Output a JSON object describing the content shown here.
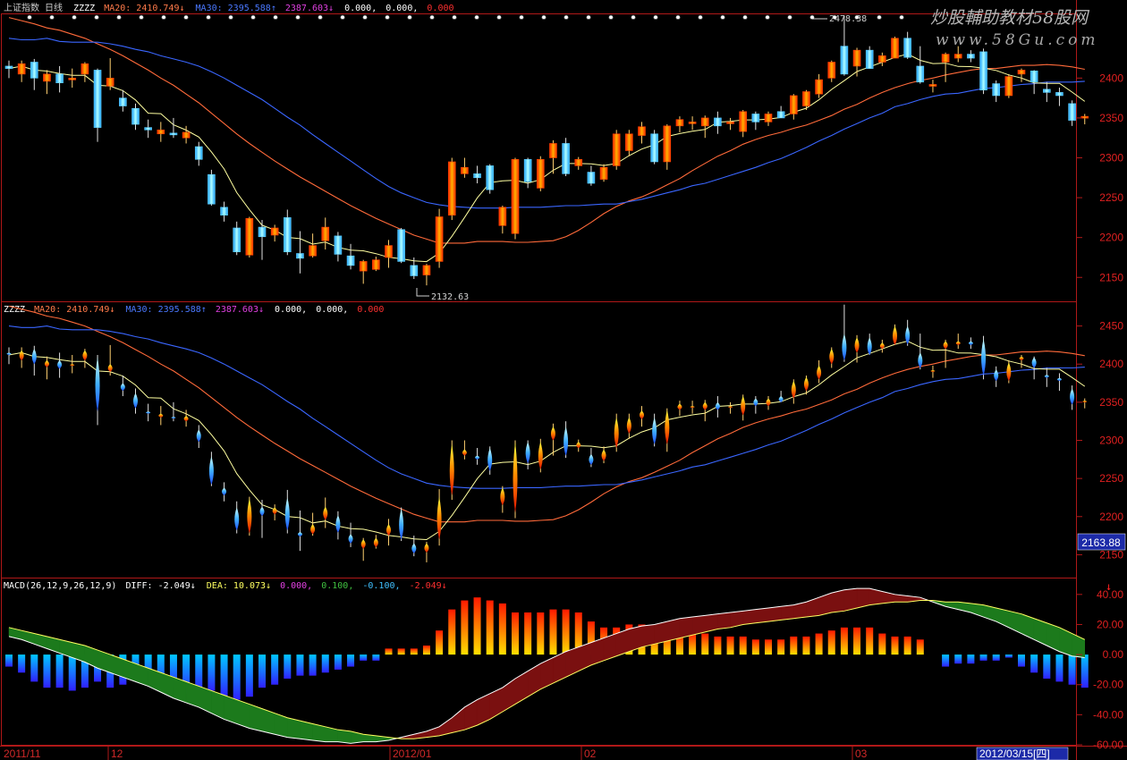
{
  "header": {
    "top": {
      "prefix": "上证指数 日线",
      "ind": "ZZZZ",
      "ma20": "MA20: 2410.749↓",
      "ma30": "MA30: 2395.588↑",
      "v3": "2387.603↓",
      "v4": "0.000,",
      "v5": "0.000,",
      "v6": "0.000"
    },
    "mid": {
      "ind": "ZZZZ",
      "ma20": "MA20: 2410.749↓",
      "ma30": "MA30: 2395.588↑",
      "v3": "2387.603↓",
      "v4": "0.000,",
      "v5": "0.000,",
      "v6": "0.000"
    },
    "macd": {
      "name": "MACD(26,12,9,26,12,9)",
      "diff": "DIFF: -2.049↓",
      "dea": "DEA: 10.073↓",
      "v3": "0.000,",
      "v4": "0.100,",
      "v5": "-0.100,",
      "v6": "-2.049↓"
    }
  },
  "watermark": {
    "line1": "炒股輔助教材58股网",
    "line2": "www.58Gu.com"
  },
  "annotations": {
    "high": "2478.38",
    "low": "2132.63",
    "last_price": "2163.88"
  },
  "date_axis": [
    "2011/11",
    "12",
    "2012/01",
    "02",
    "03"
  ],
  "date_cursor": "2012/03/15[四]",
  "colors": {
    "background": "#000000",
    "frame": "#b01818",
    "ma20": "#ff6a3a",
    "ma30": "#3a66ff",
    "ma5": "#ffffa0",
    "up": "#ffb000",
    "down": "#40d8ff",
    "hist_up": "#ff3000",
    "hist_down": "#2040ff"
  },
  "chart_data": [
    {
      "type": "candlestick",
      "panel": "price",
      "ylim": [
        2120,
        2480
      ],
      "yticks": [
        "2400",
        "2350",
        "2300",
        "2250",
        "2200",
        "2150"
      ],
      "candles": [
        [
          2415,
          2412,
          2422,
          2400
        ],
        [
          2405,
          2418,
          2422,
          2395
        ],
        [
          2420,
          2400,
          2424,
          2385
        ],
        [
          2396,
          2405,
          2410,
          2380
        ],
        [
          2405,
          2394,
          2415,
          2382
        ],
        [
          2398,
          2400,
          2412,
          2388
        ],
        [
          2405,
          2418,
          2420,
          2395
        ],
        [
          2410,
          2338,
          2412,
          2320
        ],
        [
          2390,
          2400,
          2425,
          2385
        ],
        [
          2375,
          2365,
          2385,
          2358
        ],
        [
          2362,
          2342,
          2368,
          2335
        ],
        [
          2338,
          2335,
          2348,
          2325
        ],
        [
          2330,
          2335,
          2345,
          2320
        ],
        [
          2331,
          2330,
          2350,
          2325
        ],
        [
          2325,
          2332,
          2340,
          2318
        ],
        [
          2314,
          2298,
          2320,
          2290
        ],
        [
          2279,
          2242,
          2285,
          2240
        ],
        [
          2238,
          2228,
          2245,
          2220
        ],
        [
          2212,
          2182,
          2220,
          2178
        ],
        [
          2178,
          2224,
          2226,
          2175
        ],
        [
          2213,
          2201,
          2222,
          2172
        ],
        [
          2203,
          2212,
          2216,
          2195
        ],
        [
          2225,
          2182,
          2235,
          2178
        ],
        [
          2180,
          2174,
          2208,
          2155
        ],
        [
          2177,
          2190,
          2205,
          2175
        ],
        [
          2196,
          2213,
          2225,
          2185
        ],
        [
          2202,
          2179,
          2207,
          2170
        ],
        [
          2177,
          2165,
          2192,
          2160
        ],
        [
          2158,
          2170,
          2172,
          2142
        ],
        [
          2160,
          2172,
          2176,
          2158
        ],
        [
          2175,
          2190,
          2197,
          2162
        ],
        [
          2210,
          2170,
          2212,
          2168
        ],
        [
          2165,
          2152,
          2175,
          2148
        ],
        [
          2153,
          2165,
          2167,
          2140
        ],
        [
          2170,
          2226,
          2236,
          2162
        ],
        [
          2228,
          2295,
          2300,
          2222
        ],
        [
          2280,
          2288,
          2300,
          2275
        ],
        [
          2280,
          2275,
          2290,
          2268
        ],
        [
          2290,
          2260,
          2292,
          2255
        ],
        [
          2215,
          2238,
          2240,
          2205
        ],
        [
          2205,
          2298,
          2300,
          2198
        ],
        [
          2298,
          2270,
          2300,
          2262
        ],
        [
          2262,
          2298,
          2302,
          2258
        ],
        [
          2300,
          2318,
          2322,
          2280
        ],
        [
          2318,
          2280,
          2325,
          2277
        ],
        [
          2290,
          2298,
          2301,
          2285
        ],
        [
          2282,
          2268,
          2290,
          2265
        ],
        [
          2273,
          2288,
          2292,
          2270
        ],
        [
          2290,
          2330,
          2335,
          2285
        ],
        [
          2309,
          2330,
          2335,
          2302
        ],
        [
          2328,
          2339,
          2345,
          2318
        ],
        [
          2330,
          2295,
          2335,
          2292
        ],
        [
          2295,
          2340,
          2342,
          2285
        ],
        [
          2340,
          2348,
          2352,
          2332
        ],
        [
          2345,
          2345,
          2352,
          2335
        ],
        [
          2340,
          2350,
          2353,
          2325
        ],
        [
          2350,
          2340,
          2358,
          2330
        ],
        [
          2343,
          2345,
          2350,
          2335
        ],
        [
          2333,
          2358,
          2360,
          2326
        ],
        [
          2355,
          2345,
          2358,
          2335
        ],
        [
          2345,
          2355,
          2358,
          2340
        ],
        [
          2358,
          2350,
          2365,
          2350
        ],
        [
          2355,
          2378,
          2380,
          2348
        ],
        [
          2365,
          2383,
          2385,
          2360
        ],
        [
          2380,
          2398,
          2405,
          2375
        ],
        [
          2400,
          2420,
          2422,
          2395
        ],
        [
          2440,
          2405,
          2478,
          2403
        ],
        [
          2415,
          2435,
          2438,
          2402
        ],
        [
          2435,
          2412,
          2440,
          2412
        ],
        [
          2420,
          2428,
          2432,
          2415
        ],
        [
          2425,
          2450,
          2452,
          2425
        ],
        [
          2450,
          2426,
          2458,
          2424
        ],
        [
          2415,
          2395,
          2440,
          2393
        ],
        [
          2390,
          2392,
          2398,
          2382
        ],
        [
          2420,
          2430,
          2432,
          2395
        ],
        [
          2425,
          2430,
          2440,
          2420
        ],
        [
          2430,
          2425,
          2435,
          2420
        ],
        [
          2433,
          2385,
          2437,
          2380
        ],
        [
          2393,
          2378,
          2397,
          2370
        ],
        [
          2378,
          2402,
          2405,
          2375
        ],
        [
          2405,
          2410,
          2412,
          2395
        ],
        [
          2409,
          2395,
          2410,
          2380
        ],
        [
          2386,
          2382,
          2395,
          2370
        ],
        [
          2382,
          2378,
          2388,
          2365
        ],
        [
          2368,
          2347,
          2372,
          2340
        ],
        [
          2350,
          2352,
          2355,
          2342
        ]
      ],
      "series": [
        {
          "name": "MA20",
          "values": [
            2476,
            2472,
            2468,
            2463,
            2460,
            2455,
            2450,
            2443,
            2436,
            2428,
            2419,
            2410,
            2400,
            2391,
            2380,
            2369,
            2356,
            2343,
            2330,
            2318,
            2307,
            2296,
            2286,
            2276,
            2267,
            2258,
            2249,
            2240,
            2232,
            2224,
            2217,
            2210,
            2203,
            2198,
            2193,
            2193,
            2193,
            2195,
            2195,
            2195,
            2194,
            2194,
            2195,
            2196,
            2201,
            2209,
            2219,
            2230,
            2239,
            2246,
            2251,
            2258,
            2266,
            2274,
            2284,
            2293,
            2302,
            2309,
            2317,
            2323,
            2328,
            2332,
            2337,
            2341,
            2347,
            2353,
            2361,
            2367,
            2375,
            2382,
            2388,
            2393,
            2397,
            2400,
            2404,
            2407,
            2410,
            2412,
            2412,
            2414,
            2416,
            2416,
            2417,
            2416,
            2414,
            2411
          ]
        },
        {
          "name": "MA30",
          "values": [
            2450,
            2448,
            2448,
            2450,
            2446,
            2445,
            2445,
            2445,
            2443,
            2440,
            2436,
            2433,
            2428,
            2424,
            2420,
            2415,
            2408,
            2400,
            2391,
            2382,
            2373,
            2362,
            2351,
            2341,
            2329,
            2318,
            2307,
            2296,
            2285,
            2274,
            2264,
            2256,
            2250,
            2244,
            2241,
            2239,
            2238,
            2237,
            2237,
            2237,
            2238,
            2238,
            2238,
            2239,
            2240,
            2240,
            2241,
            2242,
            2242,
            2245,
            2248,
            2252,
            2256,
            2260,
            2265,
            2268,
            2273,
            2278,
            2283,
            2288,
            2294,
            2299,
            2306,
            2313,
            2321,
            2328,
            2336,
            2343,
            2350,
            2356,
            2364,
            2368,
            2373,
            2377,
            2380,
            2381,
            2384,
            2387,
            2388,
            2390,
            2392,
            2393,
            2395,
            2395,
            2395,
            2396
          ]
        }
      ]
    },
    {
      "type": "candlestick",
      "panel": "flame",
      "ylim": [
        2120,
        2480
      ],
      "yticks": [
        "2450",
        "2400",
        "2350",
        "2300",
        "2250",
        "2200",
        "2150"
      ]
    },
    {
      "type": "bar",
      "panel": "macd",
      "ylim": [
        -60,
        50
      ],
      "yticks": [
        "40.00",
        "20.00",
        "0.00",
        "-20.00",
        "-40.00",
        "-60.00"
      ],
      "histogram": [
        -8,
        -12,
        -18,
        -22,
        -22,
        -24,
        -22,
        -18,
        -22,
        -20,
        -14,
        -18,
        -22,
        -22,
        -26,
        -24,
        -24,
        -28,
        -30,
        -28,
        -22,
        -20,
        -16,
        -14,
        -14,
        -12,
        -10,
        -8,
        -4,
        -4,
        4,
        4,
        4,
        6,
        16,
        30,
        36,
        38,
        36,
        34,
        28,
        28,
        28,
        30,
        30,
        28,
        22,
        18,
        18,
        20,
        20,
        18,
        16,
        14,
        14,
        14,
        12,
        12,
        12,
        10,
        10,
        10,
        12,
        12,
        14,
        16,
        18,
        18,
        18,
        14,
        12,
        12,
        10,
        0,
        -8,
        -6,
        -6,
        -4,
        -4,
        -2,
        -8,
        -12,
        -16,
        -18,
        -20,
        -22
      ],
      "series": [
        {
          "name": "DIFF",
          "values": [
            12,
            10,
            7,
            4,
            1,
            -2,
            -5,
            -9,
            -12,
            -15,
            -18,
            -21,
            -25,
            -29,
            -32,
            -35,
            -39,
            -43,
            -46,
            -49,
            -51,
            -53,
            -55,
            -56,
            -57,
            -58,
            -58,
            -59,
            -58,
            -58,
            -57,
            -55,
            -53,
            -51,
            -48,
            -42,
            -35,
            -30,
            -26,
            -22,
            -16,
            -11,
            -6,
            -2,
            2,
            5,
            8,
            11,
            14,
            17,
            19,
            20,
            22,
            24,
            25,
            26,
            27,
            28,
            29,
            30,
            31,
            32,
            33,
            35,
            38,
            41,
            43,
            44,
            44,
            42,
            40,
            39,
            38,
            35,
            32,
            30,
            28,
            25,
            22,
            18,
            14,
            10,
            6,
            2,
            -1,
            -2
          ]
        },
        {
          "name": "DEA",
          "values": [
            18,
            16,
            14,
            12,
            10,
            8,
            6,
            3,
            0,
            -3,
            -6,
            -9,
            -12,
            -15,
            -18,
            -21,
            -24,
            -27,
            -30,
            -33,
            -36,
            -39,
            -42,
            -44,
            -46,
            -48,
            -50,
            -51,
            -53,
            -54,
            -55,
            -56,
            -56,
            -55,
            -54,
            -52,
            -50,
            -47,
            -43,
            -38,
            -33,
            -28,
            -23,
            -19,
            -15,
            -11,
            -7,
            -4,
            -1,
            2,
            5,
            7,
            9,
            11,
            13,
            15,
            17,
            18,
            20,
            21,
            22,
            23,
            24,
            25,
            26,
            28,
            29,
            31,
            33,
            34,
            35,
            35,
            36,
            36,
            35,
            35,
            34,
            33,
            31,
            29,
            27,
            24,
            21,
            18,
            14,
            10
          ]
        }
      ]
    }
  ]
}
